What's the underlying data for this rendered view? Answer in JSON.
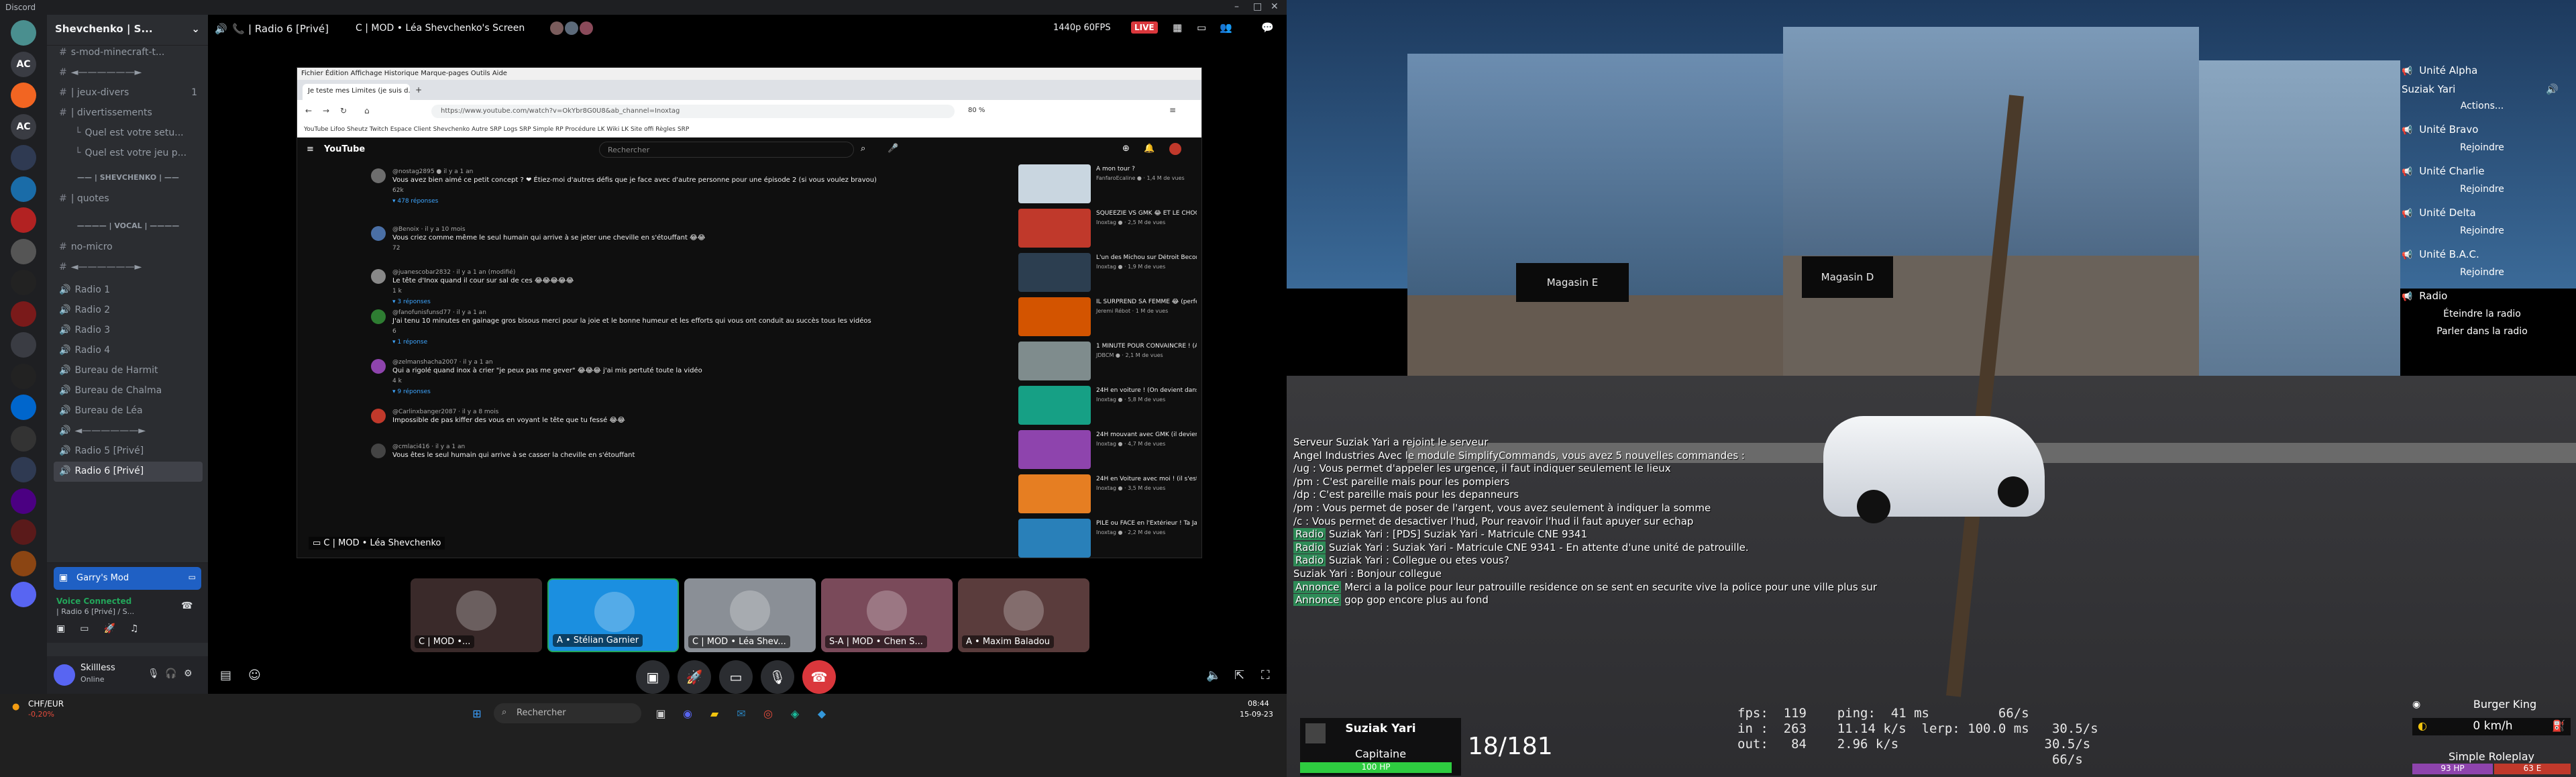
{
  "window": {
    "app": "Discord"
  },
  "servers": [
    "",
    "AC",
    "",
    "AC",
    "",
    "",
    "",
    "",
    "",
    "",
    "",
    "",
    "",
    "",
    "",
    "",
    "",
    "",
    ""
  ],
  "server_name": "Shevchenko | S...",
  "channels": [
    {
      "label": "s-mod-minecraft-t...",
      "type": "text"
    },
    {
      "label": "◄——————►",
      "type": "text"
    },
    {
      "label": "| jeux-divers",
      "type": "text",
      "count": "1"
    },
    {
      "label": "| divertissements",
      "type": "text"
    },
    {
      "label": "Quel est votre setu...",
      "type": "thread"
    },
    {
      "label": "Quel est votre jeu p...",
      "type": "thread"
    },
    {
      "label": "—— | SHEVCHENKO | ——",
      "type": "category"
    },
    {
      "label": "| quotes",
      "type": "text"
    },
    {
      "label": "———— | VOCAL | ————",
      "type": "category"
    },
    {
      "label": "no-micro",
      "type": "text"
    },
    {
      "label": "◄——————►",
      "type": "text"
    },
    {
      "label": "Radio 1",
      "type": "voice"
    },
    {
      "label": "Radio 2",
      "type": "voice"
    },
    {
      "label": "Radio 3",
      "type": "voice"
    },
    {
      "label": "Radio 4",
      "type": "voice"
    },
    {
      "label": "Bureau de Harmit",
      "type": "voice"
    },
    {
      "label": "Bureau de Chalma",
      "type": "voice"
    },
    {
      "label": "Bureau de Léa",
      "type": "voice"
    },
    {
      "label": "◄——————►",
      "type": "voice"
    },
    {
      "label": "Radio 5 [Privé]",
      "type": "voice"
    },
    {
      "label": "Radio 6 [Privé]",
      "type": "voice",
      "selected": true
    }
  ],
  "activity": {
    "game": "Garry's Mod"
  },
  "voice": {
    "status": "Voice Connected",
    "channel": "| Radio 6 [Privé] / S..."
  },
  "user": {
    "name": "Skillless",
    "status": "Online"
  },
  "stage": {
    "channel": "| Radio 6 [Privé]",
    "screen_title": "C | MOD • Léa Shevchenko's Screen",
    "quality": "1440p 60FPS",
    "live": "LIVE",
    "screen_label": "C | MOD • Léa Shevchenko"
  },
  "browser": {
    "menu": "Fichier   Édition   Affichage   Historique   Marque-pages   Outils   Aide",
    "tab": "Je teste mes Limites (je suis d...",
    "url": "https://www.youtube.com/watch?v=OkYbr8G0U8&ab_channel=Inoxtag",
    "zoom": "80 %",
    "bookmarks": "YouTube   Lifoo   Sheutz   Twitch   Espace Client   Shevchenko   Autre SRP   Logs SRP   Simple RP   Procédure   LK Wiki   LK Site offi   Règles SRP"
  },
  "youtube": {
    "logo": "YouTube",
    "search_placeholder": "Rechercher",
    "comments": [
      {
        "name": "@nostag2895 ● il y a 1 an",
        "text": "Vous avez bien aimé ce petit concept ? ❤ Étiez-moi d'autres défis que je face avec d'autre personne pour une épisode 2 (si vous voulez bravou)",
        "likes": "62k",
        "more": "▾ 478 réponses",
        "color": "#6d6d6d"
      },
      {
        "name": "@Benoix · il y a 10 mois",
        "text": "Vous criez comme même le seul humain qui arrive à se jeter une cheville en s'étouffant 😂😂",
        "likes": "72",
        "more": "",
        "color": "#4a6fa5"
      },
      {
        "name": "@juanescobar2832 · il y a 1 an (modifié)",
        "text": "Le tête d'Inox quand il cour sur sal de ces 😂😂😂😂😂",
        "likes": "1 k",
        "more": "▾ 3 réponses",
        "color": "#888"
      },
      {
        "name": "@fanofunisfunsd77 · il y a 1 an",
        "text": "J'ai tenu 10 minutes en gainage gros bisous merci pour la joie et le bonne humeur et les efforts qui vous ont conduit au succès tous les vidéos",
        "likes": "6",
        "more": "▾ 1 réponse",
        "color": "#2e7d32"
      },
      {
        "name": "@zelmanshacha2007 · il y a 1 an",
        "text": "Qui a rigolé quand inox à crier \"je peux pas me gever\" 😂😂😂 j'ai mis pertuté toute la vidéo",
        "likes": "4 k",
        "more": "▾ 9 réponses",
        "color": "#8e44ad"
      },
      {
        "name": "@Carlinxbanger2087 · il y a 8 mois",
        "text": "Impossible de pas kiffer des vous en voyant le tête que tu fessé 😂😂",
        "likes": "",
        "more": "",
        "color": "#c0392b"
      },
      {
        "name": "@cmlaci416 · il y a 1 an",
        "text": "Vous êtes le seul humain qui arrive à se casser la cheville en s'étouffant",
        "likes": "",
        "more": "",
        "color": "#444"
      }
    ],
    "recs": [
      {
        "title": "À mon tour ?",
        "author": "FanfaroEcaline ● · 1,4 M de vues",
        "color": "#c9d6e0"
      },
      {
        "title": "SQUEEZIE VS GMK 😂 ET LE CHOC DES TITANS",
        "author": "Inoxtag ● · 2,5 M de vues",
        "color": "#c0392b"
      },
      {
        "title": "L'un des Michou sur Détroit Become Human ! (Premier fois...",
        "author": "Inoxtag ● · 1,9 M de vues",
        "color": "#2c3e50"
      },
      {
        "title": "IL SURPREND SA FEMME 😂 (perfectly cut screams)",
        "author": "Jeremi Rébot · 1 M de vues",
        "color": "#d35400"
      },
      {
        "title": "1 MINUTE POUR CONVAINCRE ! (Avec Inoxtag, Theokaban)",
        "author": "JDBCM ● · 2,1 M de vues",
        "color": "#7f8c8d"
      },
      {
        "title": "24H en voiture ! (On devient dans fou...)",
        "author": "Inoxtag ● · 5,8 M de vues",
        "color": "#16a085"
      },
      {
        "title": "24H mouvant avec GMK (il devient fou...)",
        "author": "Inoxtag ● · 4,7 M de vues",
        "color": "#8e44ad"
      },
      {
        "title": "24H en Voiture avec moi ! (il s'est passé des trucs de fou...",
        "author": "Inoxtag ● · 3,5 M de vues",
        "color": "#e67e22"
      },
      {
        "title": "PILE ou FACE en l'Extérieur ! Ta Jarre peut... (feat Michi)...",
        "author": "Inoxtag ● · 2,2 M de vues",
        "color": "#2980b9"
      }
    ]
  },
  "participants": [
    {
      "label": "C | MOD •...",
      "color": "#3a2a2a"
    },
    {
      "label": "A • Stélian Garnier",
      "color": "#1b8fe0"
    },
    {
      "label": "C | MOD • Léa Shev...",
      "color": "#8a8f96"
    },
    {
      "label": "S-A | MOD • Chen S...",
      "color": "#7a4a5a"
    },
    {
      "label": "A • Maxim Baladou",
      "color": "#5a3c3c"
    }
  ],
  "taskbar": {
    "weather": "CHF/EUR",
    "weather_sub": "-0,20%",
    "search": "Rechercher",
    "time": "08:44",
    "date": "15-09-23"
  },
  "game": {
    "radio_panel": [
      {
        "text": "Unité Alpha",
        "kind": "unit"
      },
      {
        "text": "Suziak Yari",
        "kind": "member"
      },
      {
        "text": "Actions...",
        "kind": "action"
      },
      {
        "text": "Unité Bravo",
        "kind": "unit"
      },
      {
        "text": "Rejoindre",
        "kind": "action"
      },
      {
        "text": "Unité Charlie",
        "kind": "unit"
      },
      {
        "text": "Rejoindre",
        "kind": "action"
      },
      {
        "text": "Unité Delta",
        "kind": "unit"
      },
      {
        "text": "Rejoindre",
        "kind": "action"
      },
      {
        "text": "Unité B.A.C.",
        "kind": "unit"
      },
      {
        "text": "Rejoindre",
        "kind": "action"
      },
      {
        "text": "Radio",
        "kind": "unit"
      },
      {
        "text": "Éteindre la radio",
        "kind": "action"
      },
      {
        "text": "Parler dans la radio",
        "kind": "action"
      }
    ],
    "shop_signs": [
      "Magasin E",
      "Magasin D"
    ],
    "chat": [
      {
        "tag": "",
        "text": "Serveur Suziak Yari a rejoint le serveur"
      },
      {
        "tag": "",
        "text": "Angel Industries  Avec le module SimplifyCommands, vous avez 5 nouvelles commandes :"
      },
      {
        "tag": "",
        "text": "/ug : Vous permet d'appeler les urgence, il faut indiquer seulement le lieux"
      },
      {
        "tag": "",
        "text": "/pm : C'est pareille mais pour les pompiers"
      },
      {
        "tag": "",
        "text": "/dp : C'est pareille mais pour les depanneurs"
      },
      {
        "tag": "",
        "text": "/pm : Vous permet de poser de l'argent, vous avez seulement à indiquer la somme"
      },
      {
        "tag": "",
        "text": "/c : Vous permet de desactiver l'hud, Pour reavoir l'hud il faut apuyer sur echap"
      },
      {
        "tag": "Radio",
        "tagcolor": "#2e8b57",
        "text": " Suziak Yari :  [PDS] Suziak Yari - Matricule CNE 9341"
      },
      {
        "tag": "Radio",
        "tagcolor": "#2e8b57",
        "text": " Suziak Yari :  Suziak Yari - Matricule CNE 9341 - En attente d'une unité de patrouille."
      },
      {
        "tag": "Radio",
        "tagcolor": "#2e8b57",
        "text": " Suziak Yari :  Collegue ou etes vous?"
      },
      {
        "tag": "",
        "text": "Suziak Yari :  Bonjour collegue"
      },
      {
        "tag": "Annonce",
        "tagcolor": "#2e8b57",
        "text": " Merci a la police pour leur patrouille residence on se sent en securite  vive la police pour une ville plus sur"
      },
      {
        "tag": "Annonce",
        "tagcolor": "#2e8b57",
        "text": " gop gop encore plus au fond"
      }
    ],
    "player": {
      "name": "Suziak Yari",
      "rank": "Capitaine",
      "hp": "100 HP"
    },
    "ammo": "18/181",
    "net": "fps:  119    ping:  41 ms         66/s\nin :  263    11.14 k/s  lerp: 100.0 ms   30.5/s\nout:   84    2.96 k/s                   30.5/s\n                                         66/s",
    "vehicle": {
      "name": "Burger King",
      "speed": "0 km/h",
      "server": "Simple Roleplay",
      "hp": "93 HP",
      "armor": "63 E"
    }
  }
}
